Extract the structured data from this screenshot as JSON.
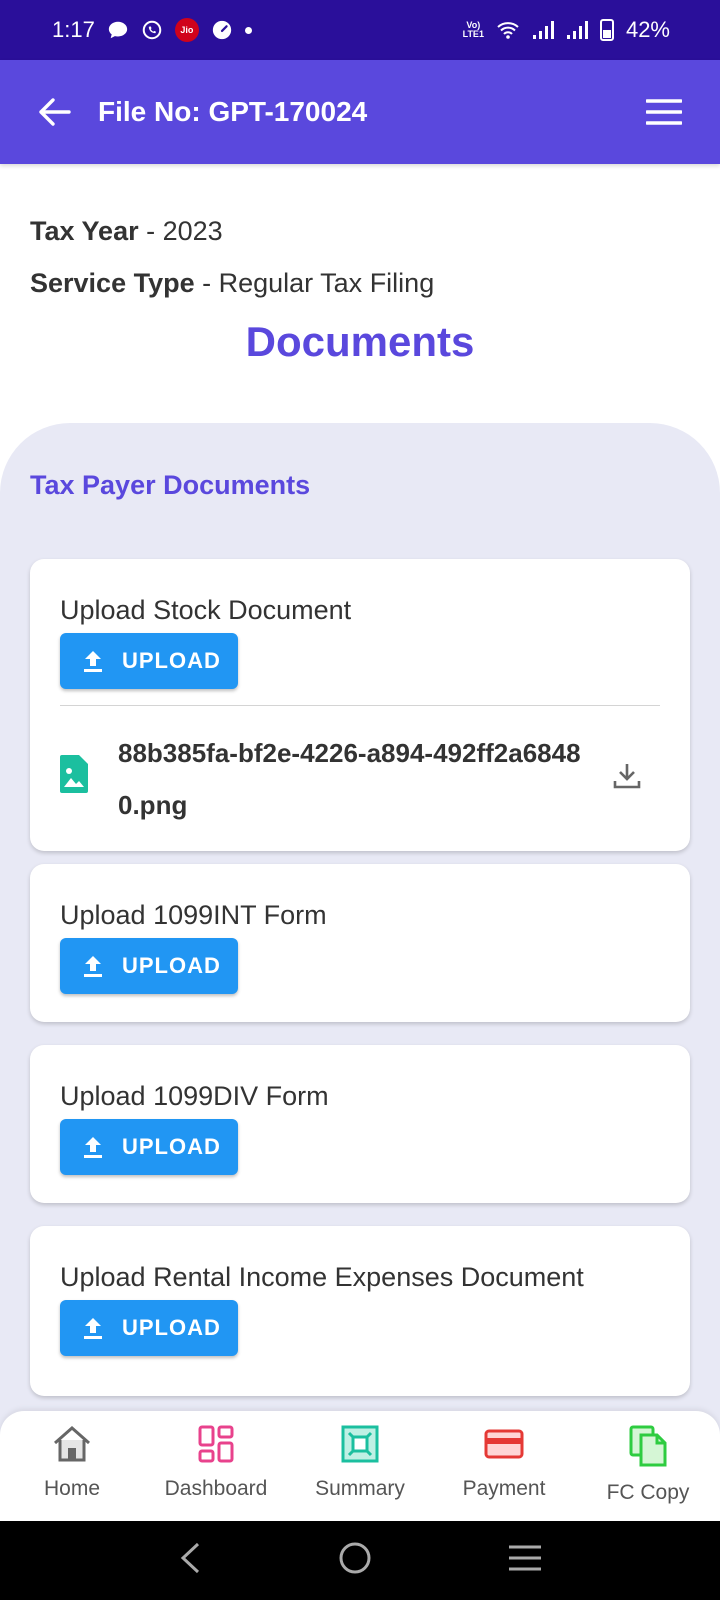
{
  "status_bar": {
    "time": "1:17",
    "carrier_badge": "Jio",
    "volte_top": "Vo)",
    "volte_bottom": "LTE1",
    "battery": "42%"
  },
  "app_bar": {
    "title": "File No: GPT-170024"
  },
  "info": {
    "tax_year_label": "Tax Year",
    "tax_year_value": " - 2023",
    "service_type_label": "Service Type",
    "service_type_value": " - Regular Tax Filing"
  },
  "page_title": "Documents",
  "panel": {
    "title": "Tax Payer Documents",
    "upload_label": "UPLOAD",
    "cards": [
      {
        "title": "Upload Stock Document",
        "file_name": "88b385fa-bf2e-4226-a894-492ff2a68480.png"
      },
      {
        "title": "Upload 1099INT Form"
      },
      {
        "title": "Upload 1099DIV Form"
      },
      {
        "title": "Upload Rental Income Expenses Document"
      }
    ]
  },
  "bottom_nav": {
    "items": [
      {
        "label": "Home",
        "icon": "home-icon",
        "color": "#666666"
      },
      {
        "label": "Dashboard",
        "icon": "dashboard-icon",
        "color": "#e8428c"
      },
      {
        "label": "Summary",
        "icon": "summary-icon",
        "color": "#1bbf9f"
      },
      {
        "label": "Payment",
        "icon": "payment-card-icon",
        "color": "#e53935"
      },
      {
        "label": "FC Copy",
        "icon": "copy-icon",
        "color": "#2ecc40"
      }
    ]
  },
  "colors": {
    "status_bar": "#2a0f9a",
    "app_bar": "#5a48dd",
    "accent": "#5a48dd",
    "upload_button": "#2196f3",
    "panel_bg": "#e8e9f5",
    "file_icon": "#1bbf9f"
  }
}
